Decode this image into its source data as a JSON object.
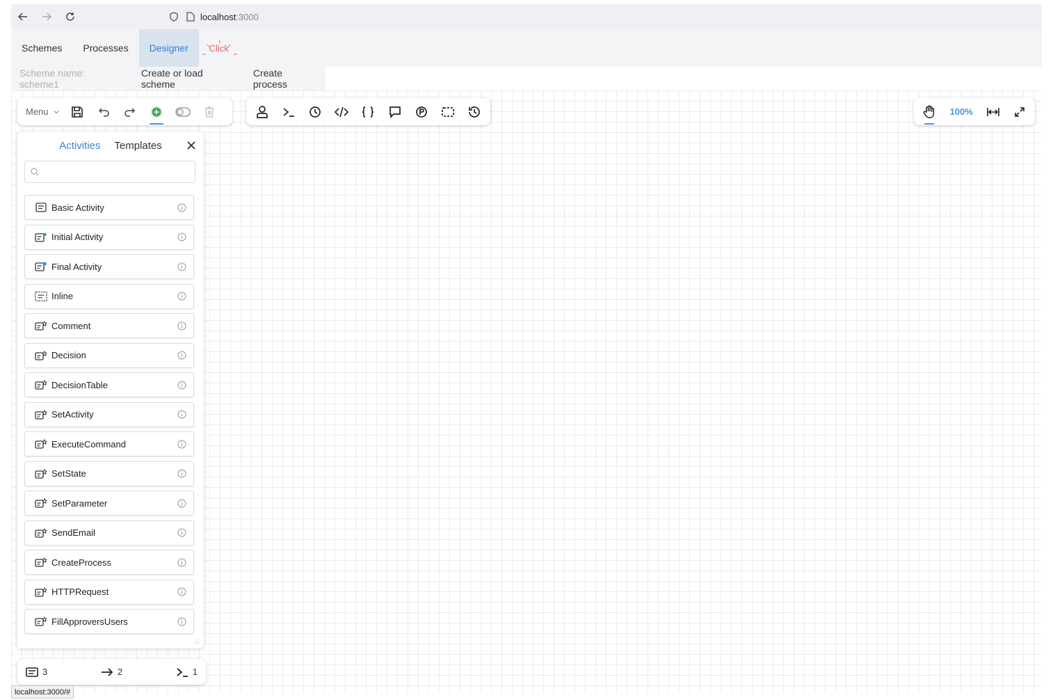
{
  "browser": {
    "url_host": "localhost",
    "url_rest": ":3000"
  },
  "nav": {
    "tabs": [
      "Schemes",
      "Processes",
      "Designer"
    ],
    "click_label": "Click"
  },
  "subnav": {
    "scheme_name": "Scheme name: scheme1",
    "create_load": "Create or load scheme",
    "create_process": "Create process"
  },
  "toolbar": {
    "menu_label": "Menu",
    "zoom": "100%"
  },
  "panel": {
    "tab_activities": "Activities",
    "tab_templates": "Templates",
    "search_placeholder": "",
    "items": [
      {
        "label": "Basic Activity",
        "icon": "basic-activity-icon"
      },
      {
        "label": "Initial Activity",
        "icon": "initial-activity-icon"
      },
      {
        "label": "Final Activity",
        "icon": "final-activity-icon"
      },
      {
        "label": "Inline",
        "icon": "inline-icon"
      },
      {
        "label": "Comment",
        "icon": "template-activity-icon"
      },
      {
        "label": "Decision",
        "icon": "template-activity-icon"
      },
      {
        "label": "DecisionTable",
        "icon": "template-activity-icon"
      },
      {
        "label": "SetActivity",
        "icon": "template-activity-icon"
      },
      {
        "label": "ExecuteCommand",
        "icon": "template-activity-icon"
      },
      {
        "label": "SetState",
        "icon": "template-activity-icon"
      },
      {
        "label": "SetParameter",
        "icon": "template-activity-icon"
      },
      {
        "label": "SendEmail",
        "icon": "template-activity-icon"
      },
      {
        "label": "CreateProcess",
        "icon": "template-activity-icon"
      },
      {
        "label": "HTTPRequest",
        "icon": "template-activity-icon"
      },
      {
        "label": "FillApproversUsers",
        "icon": "template-activity-icon"
      }
    ]
  },
  "stats": {
    "activities": "3",
    "transitions": "2",
    "commands": "1"
  },
  "statusbar": {
    "text": "localhost:3000/#"
  },
  "colors": {
    "accent": "#3b82d6",
    "active_tab_bg": "#d9e3ee",
    "add_button": "#3aa856",
    "click_text": "#e46464"
  }
}
